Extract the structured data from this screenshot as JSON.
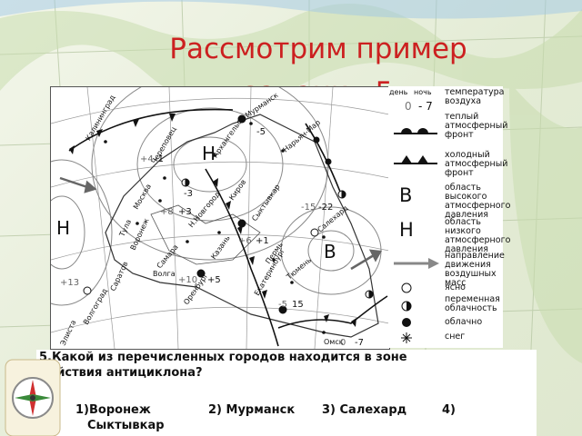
{
  "slide": {
    "title": "Рассмотрим пример\nзадания 5"
  },
  "map": {
    "pressure_labels": {
      "low_main": "Н",
      "low_west": "Н",
      "high_east": "В"
    },
    "cities": [
      "Калининград",
      "Мурманск",
      "Нарьян-Мар",
      "Архангельск",
      "Череповец",
      "Москва",
      "Тула",
      "Воронеж",
      "Саратов",
      "Самара",
      "Н.Новгород",
      "Казань",
      "Киров",
      "Пермь",
      "Екатеринбург",
      "Тюмень",
      "Сыктывкар",
      "Салехард",
      "Омск",
      "Оренбург",
      "Волгоград",
      "Элиста",
      "Волга"
    ],
    "temperatures": [
      "-5",
      "-1",
      "+4",
      "-3",
      "+8",
      "+3",
      "-15",
      "-22",
      "+1",
      "+6",
      "+13",
      "+10",
      "+5",
      "15",
      "-5",
      "0",
      "-7"
    ]
  },
  "legend": {
    "header_day": "день",
    "header_night": "ночь",
    "example_day": "0",
    "example_night": "- 7",
    "items": {
      "temperature": "температура\nвоздуха",
      "warm_front": "теплый\nатмосферный\nфронт",
      "cold_front": "холодный\nатмосферный\nфронт",
      "high_symbol": "В",
      "high": "область высокого\nатмосферного\nдавления",
      "low_symbol": "Н",
      "low": "область низкого\nатмосферного\nдавления",
      "airflow": "направление\nдвижения\nвоздушных масс",
      "clear": "ясно",
      "variable": "переменная\nоблачность",
      "cloudy": "облачно",
      "snow": "снег"
    }
  },
  "question": {
    "text": "5.Какой из перечисленных городов находится в зоне\nдействия антициклона?",
    "answers": {
      "a1": "1)Воронеж",
      "a2": "2) Мурманск",
      "a3": "3) Салехард",
      "a4": "4)",
      "a4_cont": "Сыктывкар"
    }
  }
}
